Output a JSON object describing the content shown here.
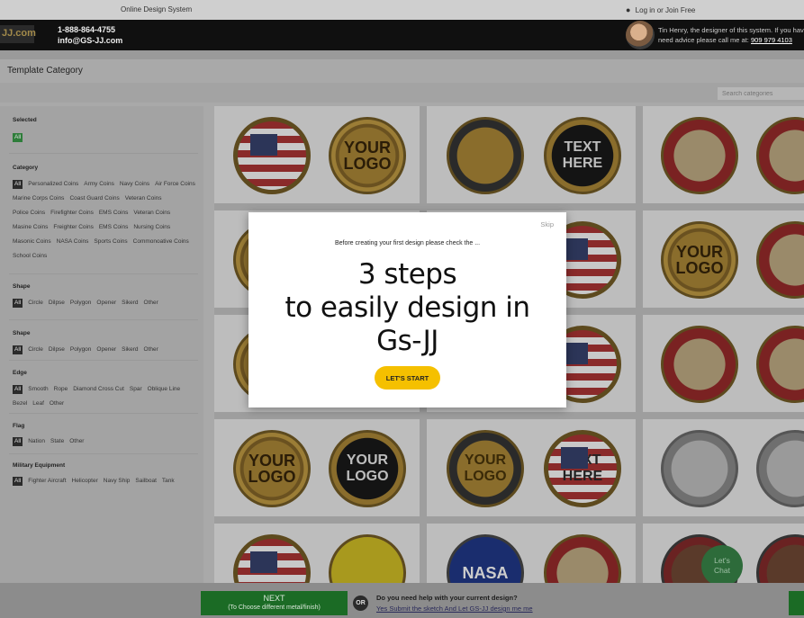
{
  "topbar": {
    "system_label": "Online Design System",
    "login_label": "Log in or Join Free"
  },
  "header": {
    "logo_text": "JJ.com",
    "phone": "1-888-864-4755",
    "email": "info@GS-JJ.com",
    "designer_line1": "Tin Henry, the designer of this system. If you have",
    "designer_line2": "need advice please call me at:",
    "designer_phone": "909 979 4103"
  },
  "page": {
    "title": "Template Category",
    "search_placeholder": "Search categories"
  },
  "sidebar": {
    "selected_heading": "Selected",
    "selected_chip": "All",
    "category_heading": "Category",
    "categories": [
      "All",
      "Personalized Coins",
      "Army Coins",
      "Navy Coins",
      "Air Force Coins",
      "Marine Corps Coins",
      "Coast Guard Coins",
      "Veteran Coins",
      "Police Coins",
      "Firefighter Coins",
      "EMS Coins",
      "Veteran Coins",
      "Masine Coins",
      "Freighter Coins",
      "EMS Coins",
      "Nursing Coins",
      "Masonic Coins",
      "NASA Coins",
      "Sports Coins",
      "Commonoative Coins",
      "School Coins"
    ],
    "shape1_heading": "Shape",
    "shape1": [
      "All",
      "Circle",
      "Dilpse",
      "Polygon",
      "Opener",
      "Sikerd",
      "Other"
    ],
    "shape2_heading": "Shape",
    "shape2": [
      "All",
      "Circle",
      "Dilpse",
      "Polygon",
      "Opener",
      "Sikerd",
      "Other"
    ],
    "edge_heading": "Edge",
    "edge": [
      "All",
      "Smooth",
      "Rope",
      "Diamond Cross Cut",
      "Spar",
      "Oblique Line",
      "Bezel",
      "Leaf",
      "Other"
    ],
    "flag_heading": "Flag",
    "flag": [
      "All",
      "Nation",
      "State",
      "Other"
    ],
    "military_heading": "Military Equipment",
    "military": [
      "All",
      "Fighter Aircraft",
      "Helicopter",
      "Navy Ship",
      "Sailboat",
      "Tank"
    ]
  },
  "coins": {
    "your_logo": "YOUR LOGO",
    "text_here": "TEXT HERE",
    "nasa": "NASA"
  },
  "modal": {
    "skip_label": "Skip",
    "intro": "Before creating your first design please check the ...",
    "title_line1": "3 steps",
    "title_line2": "to easily design in",
    "title_line3": "Gs-JJ",
    "start_label": "LET'S START"
  },
  "chat": {
    "label_line1": "Let's",
    "label_line2": "Chat"
  },
  "bottombar": {
    "next_label": "NEXT",
    "next_sub": "(To Choose different metal/finish)",
    "or_label": "OR",
    "help_question": "Do you need help with your current design?",
    "help_link": "Yes Submit the sketch And Let GS-JJ design me me"
  },
  "colors": {
    "overlay_bg": "#a9a9a9",
    "header_bg": "#101010",
    "next_green": "#1b6b25",
    "start_yellow": "#f5c000",
    "chat_green": "#2d6b3a"
  }
}
